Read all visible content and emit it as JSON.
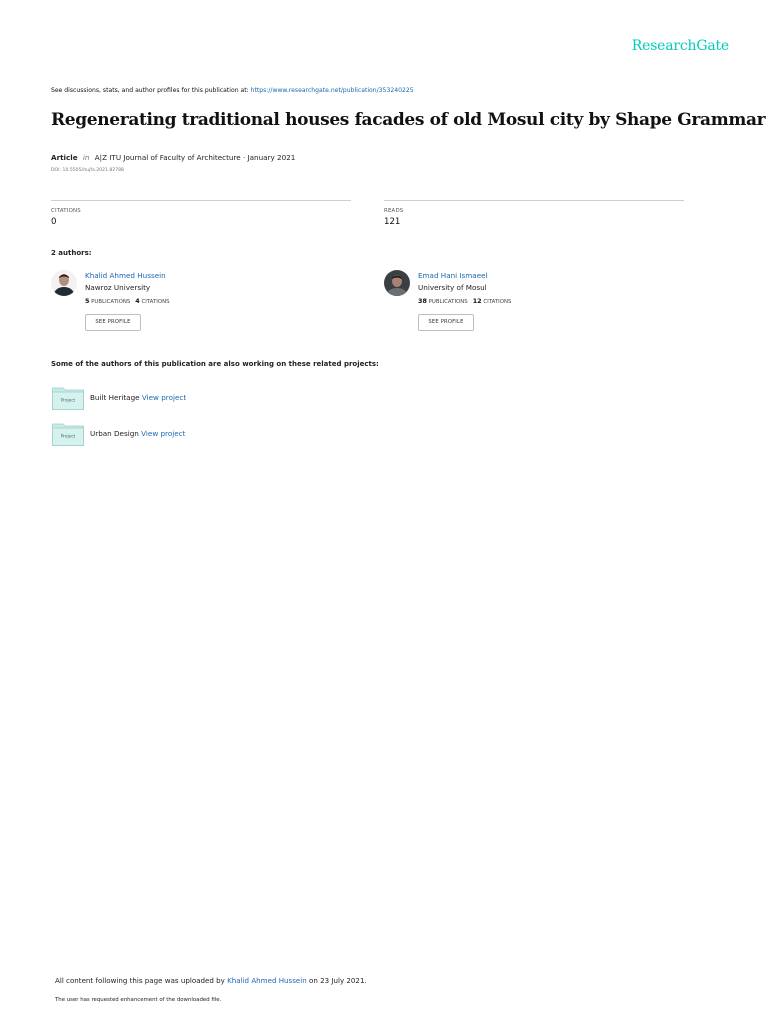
{
  "brand": "ResearchGate",
  "discussion": {
    "text": "See discussions, stats, and author profiles for this publication at: ",
    "url": "https://www.researchgate.net/publication/353240225"
  },
  "title": "Regenerating traditional houses facades of old Mosul city by Shape Grammar",
  "meta": {
    "type": "Article",
    "in": "in",
    "journal": "A|Z ITU Journal of Faculty of Architecture · January 2021",
    "doi": "DOI: 10.5505/itujfa.2021.82788"
  },
  "stats": [
    {
      "label": "CITATIONS",
      "value": "0"
    },
    {
      "label": "READS",
      "value": "121"
    }
  ],
  "authors_heading": "2 authors:",
  "authors": [
    {
      "name": "Khalid Ahmed Hussein",
      "institution": "Nawroz University",
      "publications": "5",
      "publications_label": "PUBLICATIONS",
      "citations": "4",
      "citations_label": "CITATIONS",
      "button": "SEE PROFILE"
    },
    {
      "name": "Emad Hani Ismaeel",
      "institution": "University of Mosul",
      "publications": "38",
      "publications_label": "PUBLICATIONS",
      "citations": "12",
      "citations_label": "CITATIONS",
      "button": "SEE PROFILE"
    }
  ],
  "related_heading": "Some of the authors of this publication are also working on these related projects:",
  "projects": [
    {
      "icon_label": "Project",
      "name": "Built Heritage",
      "link": "View project"
    },
    {
      "icon_label": "Project",
      "name": "Urban Design",
      "link": "View project"
    }
  ],
  "footer": {
    "upload_prefix": "All content following this page was uploaded by ",
    "uploader": "Khalid Ahmed Hussein",
    "upload_suffix": " on 23 July 2021.",
    "note": "The user has requested enhancement of the downloaded file."
  },
  "colors": {
    "brand": "#00ccbb",
    "link": "#1a67b3",
    "folder": "#c8ebe8"
  }
}
